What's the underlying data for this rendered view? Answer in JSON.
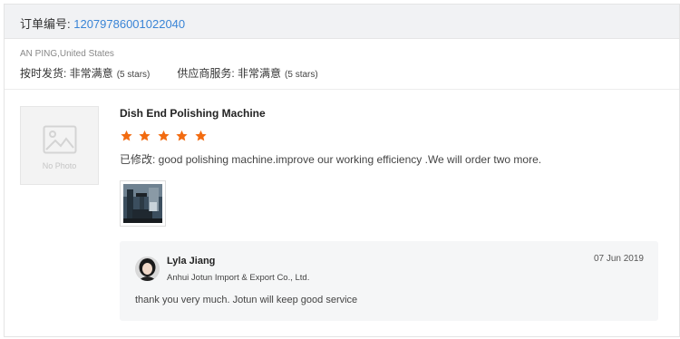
{
  "order": {
    "label": "订单编号: ",
    "number": "12079786001022040"
  },
  "buyer": {
    "location": "AN PING,United States"
  },
  "ratings": {
    "delivery_label": "按时发货: ",
    "delivery_value": "非常满意",
    "delivery_stars": "(5 stars)",
    "service_label": "供应商服务: ",
    "service_value": "非常满意",
    "service_stars": "(5 stars)"
  },
  "product": {
    "no_photo": "No Photo",
    "title": "Dish End Polishing Machine",
    "star_rating": 5,
    "star_color": "#f26b10",
    "review": "已修改: good polishing machine.improve our working efficiency .We will order two more."
  },
  "reply": {
    "name": "Lyla Jiang",
    "company": "Anhui Jotun Import & Export Co., Ltd.",
    "date": "07 Jun 2019",
    "text": "thank you very much. Jotun will keep good service"
  }
}
